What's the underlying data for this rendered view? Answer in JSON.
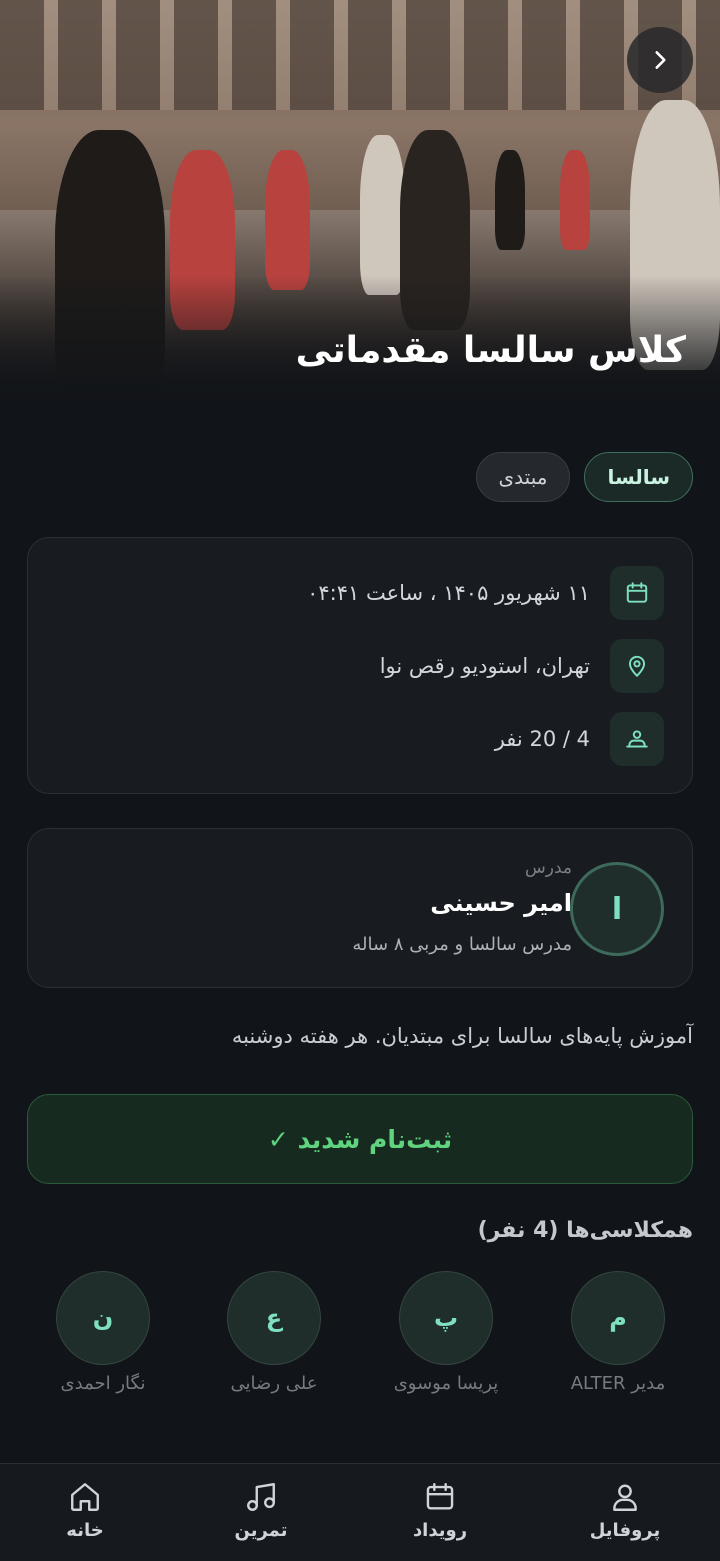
{
  "hero": {
    "title": "کلاس سالسا مقدماتی",
    "back_icon": "chevron-right-icon"
  },
  "tags": [
    "سالسا",
    "مبتدی"
  ],
  "info": {
    "datetime": "۱۱ شهریور ۱۴۰۵ ، ساعت ۰۴:۴۱",
    "location": "تهران، استودیو رقص نوا",
    "capacity": "4 / 20 نفر"
  },
  "teacher": {
    "initial": "ا",
    "role": "مدرس",
    "name": "امیر حسینی",
    "bio": "مدرس سالسا و مربی ۸ ساله"
  },
  "description": "آموزش پایه‌های سالسا برای مبتدیان. هر هفته دوشنبه",
  "register_button": "ثبت‌نام شدید ✓",
  "classmates": {
    "title": "همکلاسی‌ها (4 نفر)",
    "items": [
      {
        "initial": "م",
        "name": "مدیر ALTER"
      },
      {
        "initial": "پ",
        "name": "پریسا موسوی"
      },
      {
        "initial": "ع",
        "name": "علی رضایی"
      },
      {
        "initial": "ن",
        "name": "نگار احمدی"
      }
    ]
  },
  "nav": {
    "profile": "پروفایل",
    "event": "رویداد",
    "practice": "تمرین",
    "home": "خانه"
  },
  "colors": {
    "background": "#111418",
    "accent": "#7fe0bf",
    "success": "#5fd37d"
  }
}
